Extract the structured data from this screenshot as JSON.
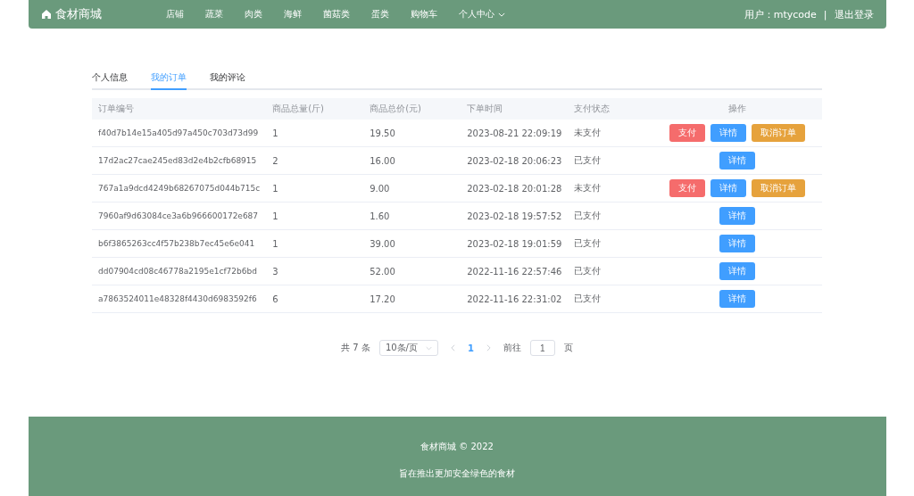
{
  "header": {
    "logo": "食材商城",
    "nav": [
      {
        "label": "店铺"
      },
      {
        "label": "蔬菜"
      },
      {
        "label": "肉类"
      },
      {
        "label": "海鲜"
      },
      {
        "label": "菌菇类"
      },
      {
        "label": "蛋类"
      },
      {
        "label": "购物车"
      },
      {
        "label": "个人中心",
        "dropdown": true
      }
    ],
    "user": "用户：mtycode",
    "separator": "|",
    "logout": "退出登录"
  },
  "tabs": [
    {
      "label": "个人信息",
      "selected": false
    },
    {
      "label": "我的订单",
      "selected": true
    },
    {
      "label": "我的评论",
      "selected": false
    }
  ],
  "table": {
    "columns": [
      "订单编号",
      "商品总量(斤)",
      "商品总价(元)",
      "下单时间",
      "支付状态",
      "操作"
    ],
    "rows": [
      {
        "id": "f40d7b14e15a405d97a450c703d73d99",
        "qty": "1",
        "price": "19.50",
        "time": "2023-08-21 22:09:19",
        "status": "未支付",
        "actions": [
          {
            "kind": "pay",
            "label": "支付"
          },
          {
            "kind": "detail",
            "label": "详情"
          },
          {
            "kind": "cancel",
            "label": "取消订单"
          }
        ]
      },
      {
        "id": "17d2ac27cae245ed83d2e4b2cfb68915",
        "qty": "2",
        "price": "16.00",
        "time": "2023-02-18 20:06:23",
        "status": "已支付",
        "actions": [
          {
            "kind": "detail",
            "label": "详情"
          }
        ]
      },
      {
        "id": "767a1a9dcd4249b68267075d044b715c",
        "qty": "1",
        "price": "9.00",
        "time": "2023-02-18 20:01:28",
        "status": "未支付",
        "actions": [
          {
            "kind": "pay",
            "label": "支付"
          },
          {
            "kind": "detail",
            "label": "详情"
          },
          {
            "kind": "cancel",
            "label": "取消订单"
          }
        ]
      },
      {
        "id": "7960af9d63084ce3a6b966600172e687",
        "qty": "1",
        "price": "1.60",
        "time": "2023-02-18 19:57:52",
        "status": "已支付",
        "actions": [
          {
            "kind": "detail",
            "label": "详情"
          }
        ]
      },
      {
        "id": "b6f3865263cc4f57b238b7ec45e6e041",
        "qty": "1",
        "price": "39.00",
        "time": "2023-02-18 19:01:59",
        "status": "已支付",
        "actions": [
          {
            "kind": "detail",
            "label": "详情"
          }
        ]
      },
      {
        "id": "dd07904cd08c46778a2195e1cf72b6bd",
        "qty": "3",
        "price": "52.00",
        "time": "2022-11-16 22:57:46",
        "status": "已支付",
        "actions": [
          {
            "kind": "detail",
            "label": "详情"
          }
        ]
      },
      {
        "id": "a7863524011e48328f4430d6983592f6",
        "qty": "6",
        "price": "17.20",
        "time": "2022-11-16 22:31:02",
        "status": "已支付",
        "actions": [
          {
            "kind": "detail",
            "label": "详情"
          }
        ]
      }
    ]
  },
  "pagination": {
    "total": "共 7 条",
    "page_size": "10条/页",
    "pages": [
      {
        "label": "1",
        "selected": true
      }
    ],
    "goto_label": "前往",
    "goto_value": "1",
    "goto_suffix": "页"
  },
  "footer": {
    "copyright": "食材商城 © 2022",
    "slogan": "旨在推出更加安全绿色的食材"
  }
}
